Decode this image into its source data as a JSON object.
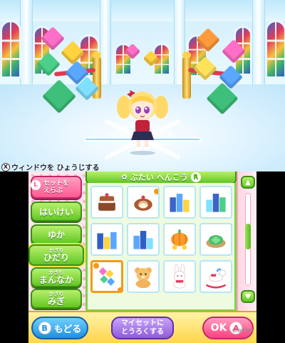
{
  "top_screen": {
    "hint": {
      "key": "X",
      "text": "ウィンドウを ひょうじする"
    }
  },
  "bottom_screen": {
    "left_menu": [
      {
        "small": "",
        "label": "セットを\nえらぶ",
        "style": "pink",
        "key": "L"
      },
      {
        "small": "",
        "label": "はいけい",
        "style": "green"
      },
      {
        "small": "",
        "label": "ゆか",
        "style": "green"
      },
      {
        "small": "かざり",
        "label": "ひだり",
        "style": "green",
        "active": true
      },
      {
        "small": "かざり",
        "label": "まんなか",
        "style": "green"
      },
      {
        "small": "かざり",
        "label": "みぎ",
        "style": "green"
      }
    ],
    "header": {
      "title": "ぶたい へんこう",
      "key": "R"
    },
    "grid_items": [
      {
        "icon": "cake-icon"
      },
      {
        "icon": "roll-cake-icon"
      },
      {
        "icon": "blue-cube-stack-icon"
      },
      {
        "icon": "blue-cube-stack-icon"
      },
      {
        "icon": "blue-cube-stack-icon"
      },
      {
        "icon": "blue-cube-stack-icon"
      },
      {
        "icon": "pumpkin-carriage-icon"
      },
      {
        "icon": "turtle-shell-icon"
      },
      {
        "icon": "gem-cluster-icon",
        "selected": true
      },
      {
        "icon": "teddy-bear-icon"
      },
      {
        "icon": "bunny-icon"
      },
      {
        "icon": "rocking-horse-icon"
      }
    ],
    "footer": {
      "back": {
        "key": "B",
        "label": "もどる"
      },
      "register": {
        "label": "マイセットに\nとうろくする"
      },
      "ok": {
        "key": "A",
        "label": "OK"
      }
    },
    "scroll_level": 0.45
  },
  "watermark": "Gamer",
  "colors": {
    "green": "#62c726",
    "pink": "#ff5a93",
    "orange_select": "#f39a1a",
    "purple": "#8e5bd9"
  }
}
